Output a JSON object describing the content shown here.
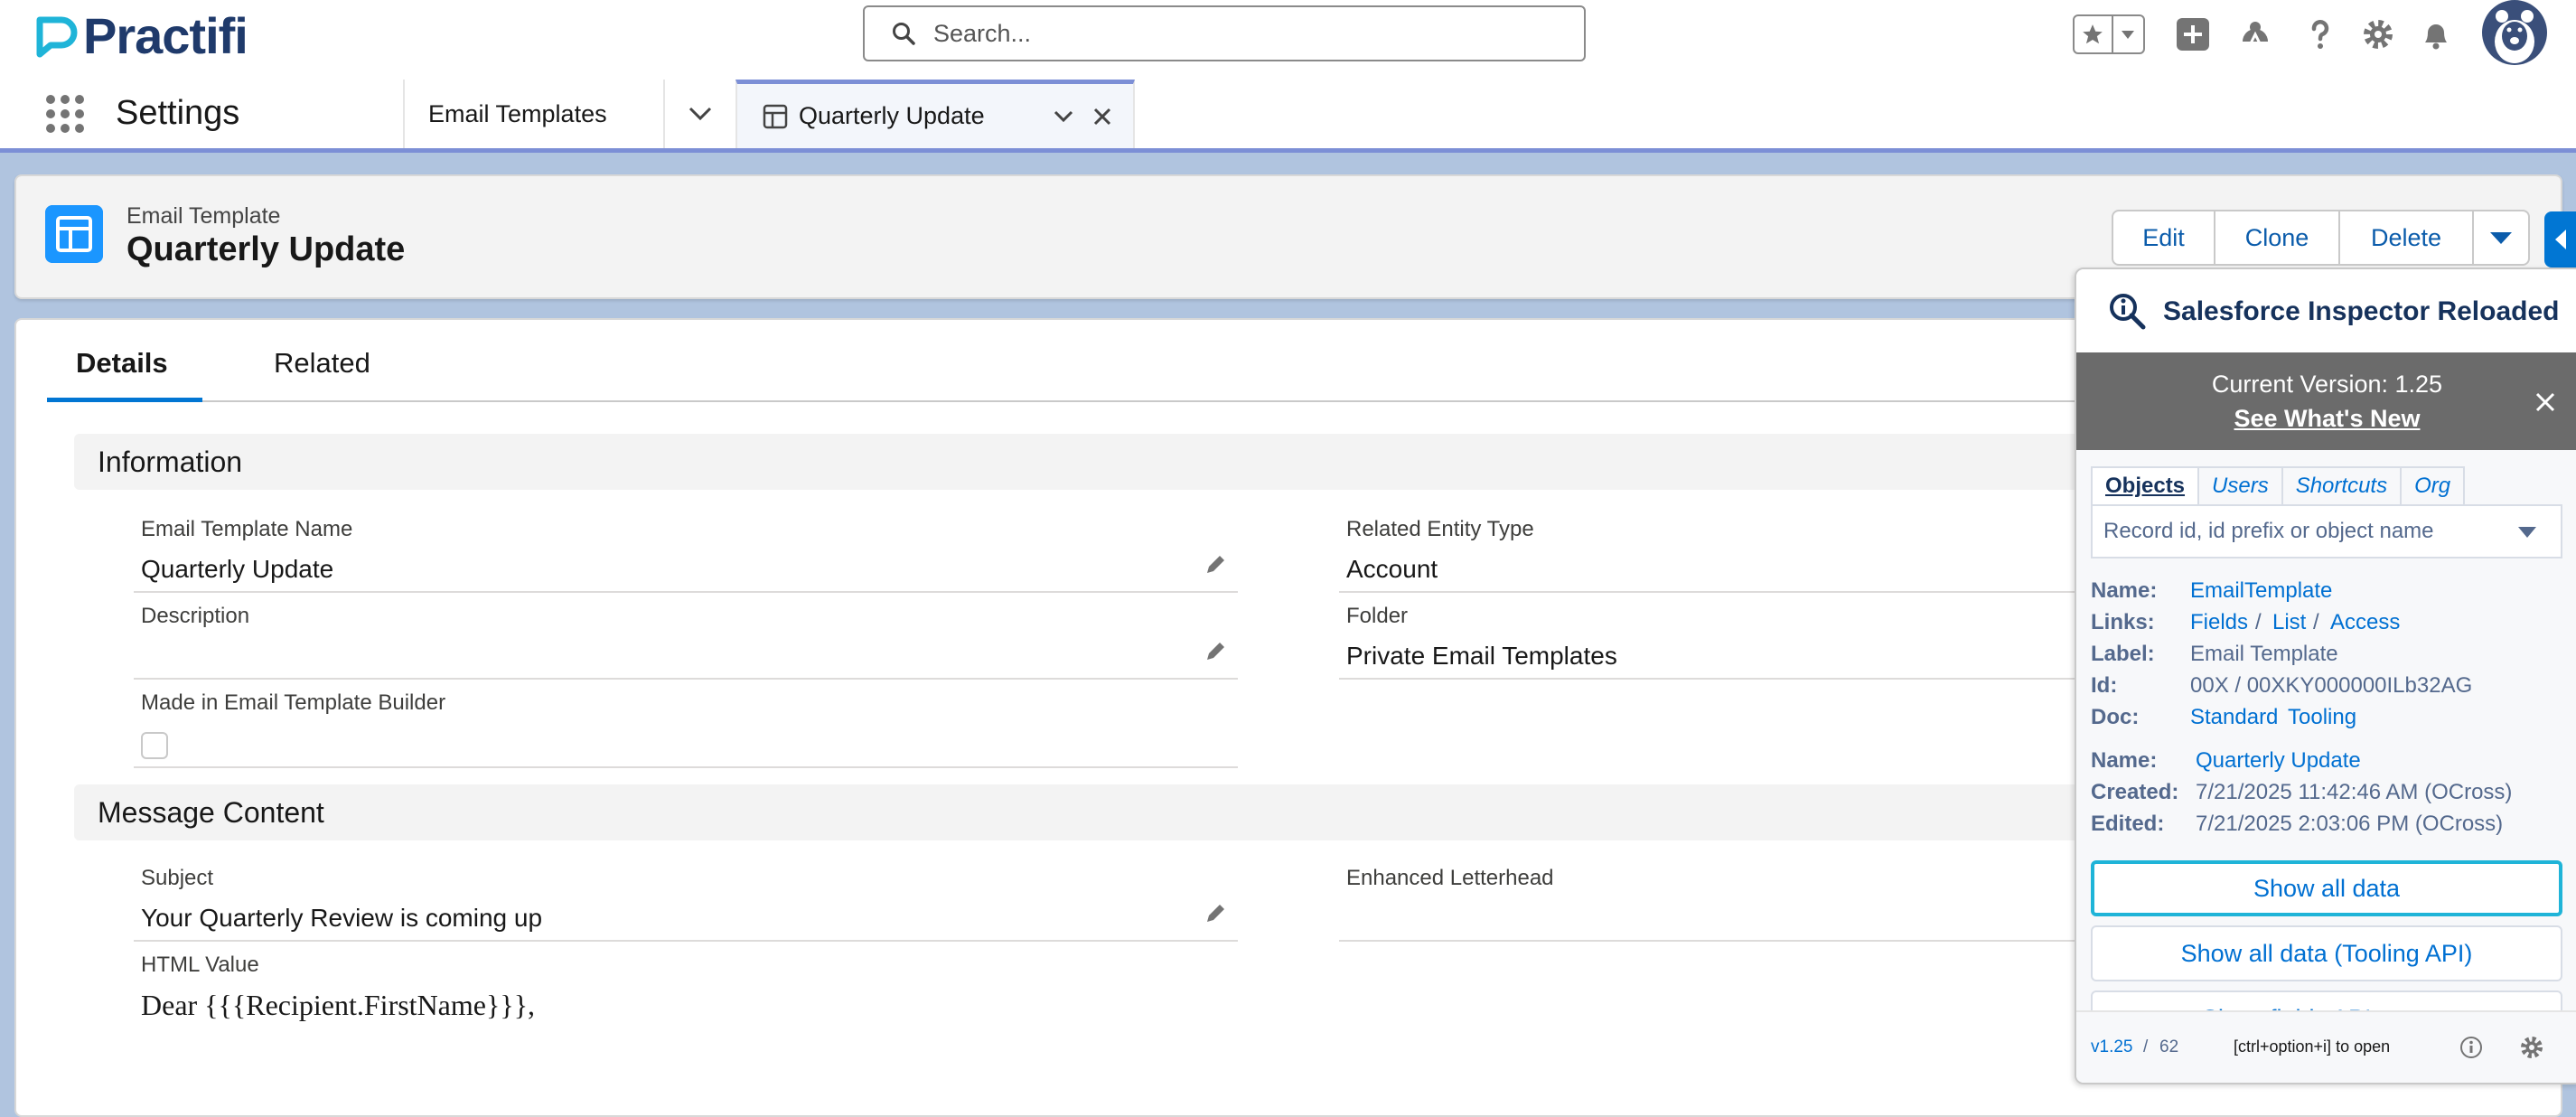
{
  "header": {
    "logo_text": "Practifi",
    "search_placeholder": "Search...",
    "brand_color": "#1f3a6b",
    "logo_color": "#1fb4d8"
  },
  "nav": {
    "app_name": "Settings",
    "tab_object": "Email Templates",
    "tab_record": "Quarterly Update",
    "accent": "#7c8fd6"
  },
  "record": {
    "type_label": "Email Template",
    "title": "Quarterly Update",
    "actions": [
      "Edit",
      "Clone",
      "Delete"
    ]
  },
  "tabs": {
    "details": "Details",
    "related": "Related"
  },
  "information": {
    "heading": "Information",
    "name_label": "Email Template Name",
    "name_value": "Quarterly Update",
    "entity_label": "Related Entity Type",
    "entity_value": "Account",
    "description_label": "Description",
    "description_value": "",
    "folder_label": "Folder",
    "folder_value": "Private Email Templates",
    "builder_label": "Made in Email Template Builder",
    "builder_checked": false
  },
  "message": {
    "heading": "Message Content",
    "subject_label": "Subject",
    "subject_value": "Your Quarterly Review is coming up",
    "letterhead_label": "Enhanced Letterhead",
    "letterhead_value": "",
    "html_label": "HTML Value",
    "html_value": "Dear {{{Recipient.FirstName}}},"
  },
  "inspector": {
    "title": "Salesforce Inspector Reloaded",
    "version_text": "Current Version: 1.25",
    "whats_new": "See What's New",
    "tabs": [
      "Objects",
      "Users",
      "Shortcuts",
      "Org"
    ],
    "search_placeholder": "Record id, id prefix or object name",
    "object": {
      "name_label": "Name:",
      "name_value": "EmailTemplate",
      "links_label": "Links:",
      "links": [
        "Fields",
        "List",
        "Access"
      ],
      "label_label": "Label:",
      "label_value": "Email Template",
      "id_label": "Id:",
      "id_value": "00X / 00XKY000000ILb32AG",
      "doc_label": "Doc:",
      "doc_links": [
        "Standard",
        "Tooling"
      ]
    },
    "record": {
      "name_label": "Name:",
      "name_value": "Quarterly Update",
      "created_label": "Created:",
      "created_value": "7/21/2025 11:42:46 AM (OCross)",
      "edited_label": "Edited:",
      "edited_value": "7/21/2025 2:03:06 PM (OCross)"
    },
    "buttons": {
      "show_all": "Show all data",
      "show_all_tooling": "Show all data (Tooling API)",
      "show_fields_api": "Show fields API names"
    },
    "footer": {
      "version_link": "v1.25",
      "separator": "/",
      "count": "62",
      "shortcut": "[ctrl+option+i] to open"
    }
  }
}
